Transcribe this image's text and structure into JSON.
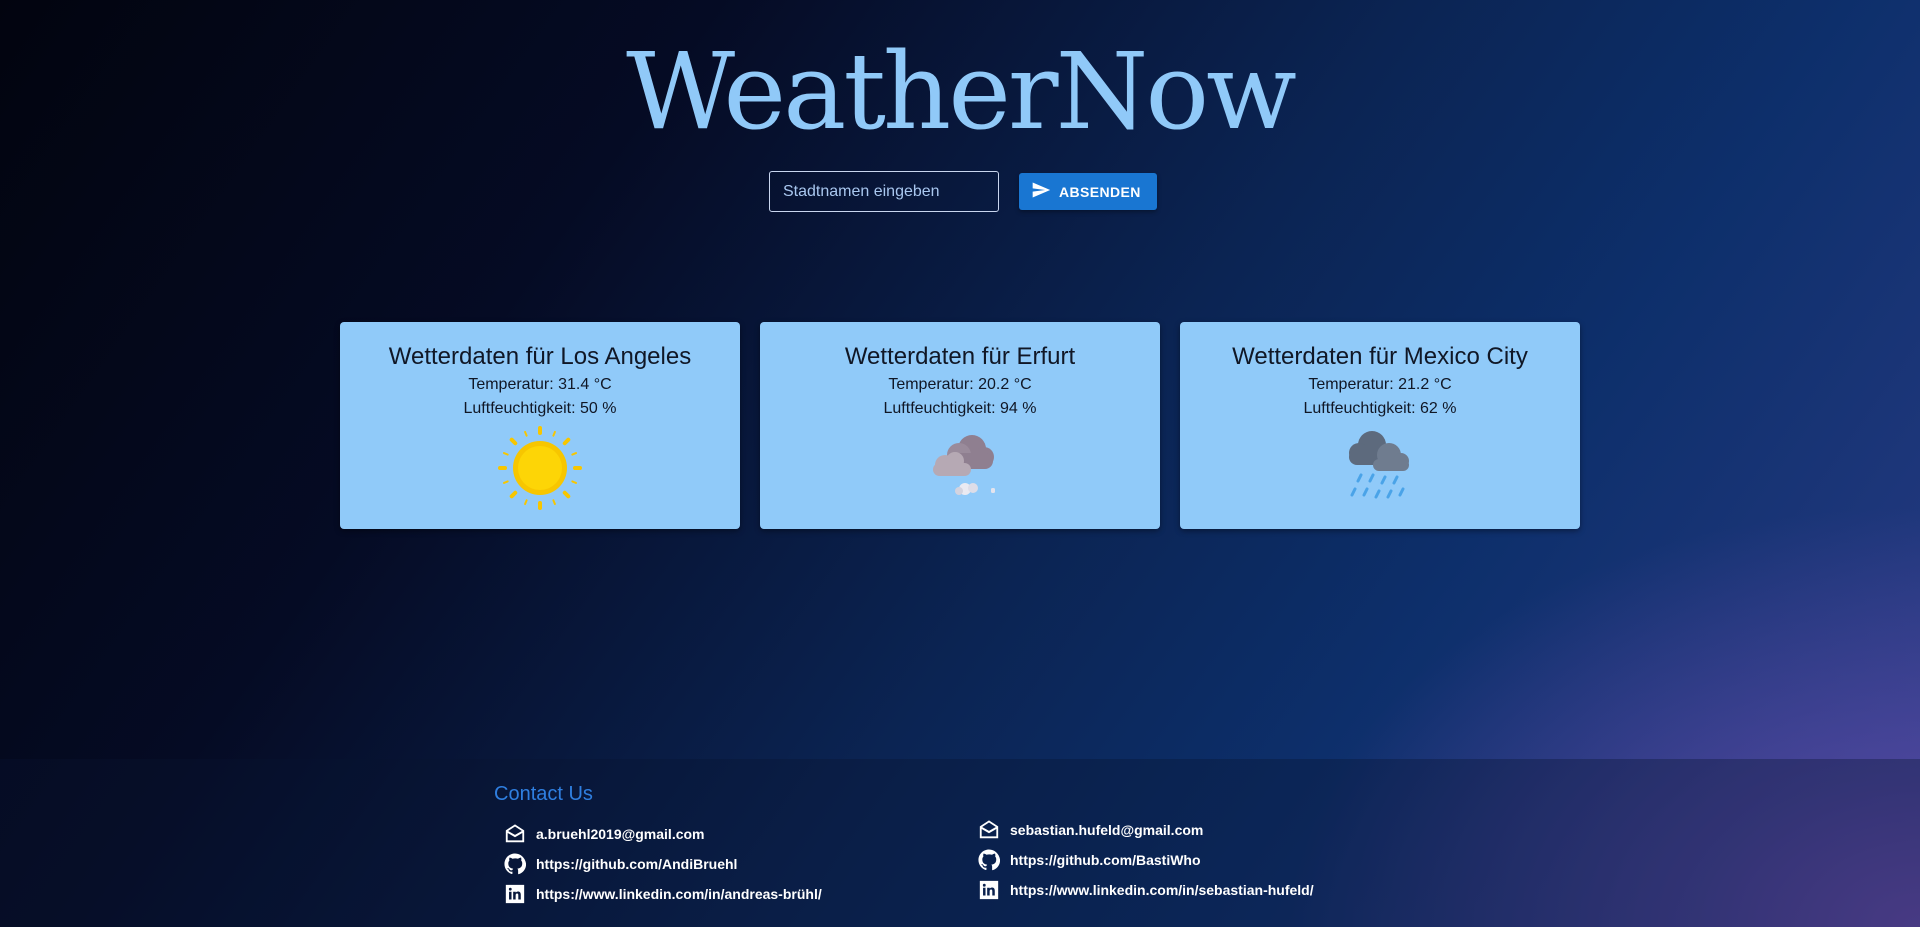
{
  "app": {
    "title": "WeatherNow"
  },
  "search": {
    "placeholder": "Stadtnamen eingeben",
    "value": "",
    "submit_label": "ABSENDEN"
  },
  "cards": [
    {
      "title": "Wetterdaten für Los Angeles",
      "temperature": "Temperatur: 31.4 °C",
      "humidity": "Luftfeuchtigkeit: 50 %",
      "icon": "sun-icon"
    },
    {
      "title": "Wetterdaten für Erfurt",
      "temperature": "Temperatur: 20.2 °C",
      "humidity": "Luftfeuchtigkeit: 94 %",
      "icon": "fog-cloud-icon"
    },
    {
      "title": "Wetterdaten für Mexico City",
      "temperature": "Temperatur: 21.2 °C",
      "humidity": "Luftfeuchtigkeit: 62 %",
      "icon": "rain-cloud-icon"
    }
  ],
  "footer": {
    "heading": "Contact Us",
    "left": [
      {
        "icon": "mail-icon",
        "text": "a.bruehl2019@gmail.com"
      },
      {
        "icon": "github-icon",
        "text": "https://github.com/AndiBruehl"
      },
      {
        "icon": "linkedin-icon",
        "text": "https://www.linkedin.com/in/andreas-brühl/"
      }
    ],
    "right": [
      {
        "icon": "mail-icon",
        "text": "sebastian.hufeld@gmail.com"
      },
      {
        "icon": "github-icon",
        "text": "https://github.com/BastiWho"
      },
      {
        "icon": "linkedin-icon",
        "text": "https://www.linkedin.com/in/sebastian-hufeld/"
      }
    ]
  },
  "colors": {
    "accent": "#1976d2",
    "title": "#90c9f8",
    "card_background": "#90caf9",
    "contact_heading": "#2f7fe0"
  }
}
